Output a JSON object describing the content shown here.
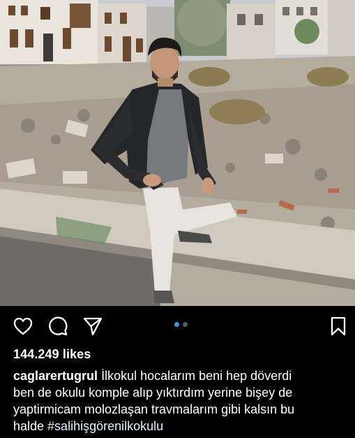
{
  "post": {
    "likes_text": "144.249 likes",
    "username": "caglarertugrul",
    "caption_lines": [
      "İlkokul hocalarım beni hep döverdi",
      "ben de okulu komple alıp yıktırdım yerine bişey de",
      "yaptirmicam molozlaşan travmalarım gibi kalsın bu",
      "halde "
    ],
    "hashtag": "#salihişgörenilkokulu",
    "carousel": {
      "count": 2,
      "active_index": 0
    }
  },
  "icons": {
    "like": "heart-icon",
    "comment": "comment-icon",
    "share": "paper-plane-icon",
    "save": "bookmark-icon"
  },
  "colors": {
    "background": "#000000",
    "text": "#ffffff",
    "dot_active": "#3897f0",
    "dot_inactive": "#5a5a5a",
    "hashtag": "#e0f1ff"
  }
}
